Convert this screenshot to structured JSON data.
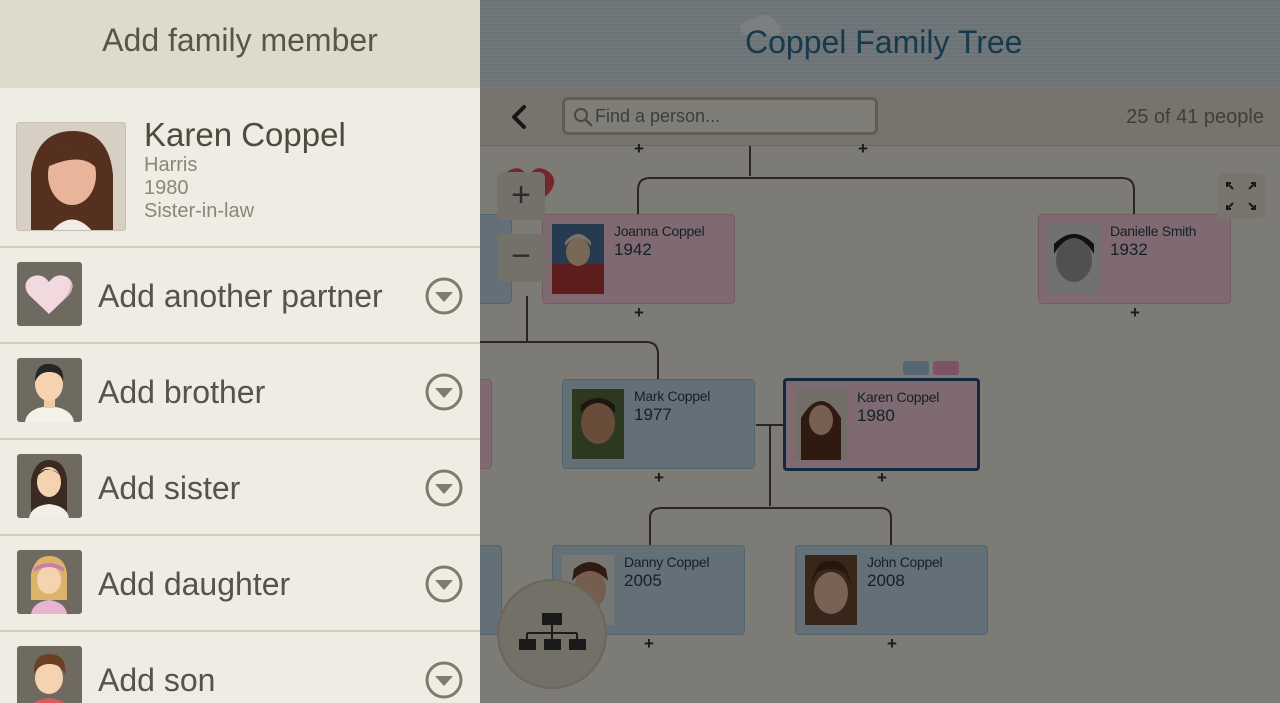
{
  "tree": {
    "title": "Coppel Family Tree",
    "search_placeholder": "Find a person...",
    "people_count": "25 of 41 people",
    "zoom_in": "+",
    "zoom_out": "−",
    "plus": "+",
    "nodes": {
      "joanna": {
        "name": "Joanna Coppel",
        "year": "1942"
      },
      "danielle": {
        "name": "Danielle Smith",
        "year": "1932"
      },
      "mark": {
        "name": "Mark Coppel",
        "year": "1977"
      },
      "karen": {
        "name": "Karen Coppel",
        "year": "1980"
      },
      "danny": {
        "name": "Danny Coppel",
        "year": "2005"
      },
      "john": {
        "name": "John Coppel",
        "year": "2008"
      }
    },
    "colors": {
      "female": "#f1cbd6",
      "male": "#bed6e4",
      "selected_border": "#1f4f7b"
    }
  },
  "drawer": {
    "title": "Add family member",
    "profile": {
      "name": "Karen Coppel",
      "maiden_name": "Harris",
      "year": "1980",
      "relation": "Sister-in-law"
    },
    "actions": [
      {
        "label": "Add another partner",
        "icon": "heart-icon"
      },
      {
        "label": "Add brother",
        "icon": "male-avatar-icon"
      },
      {
        "label": "Add sister",
        "icon": "female-avatar-icon"
      },
      {
        "label": "Add daughter",
        "icon": "girl-avatar-icon"
      },
      {
        "label": "Add son",
        "icon": "boy-avatar-icon"
      }
    ]
  }
}
